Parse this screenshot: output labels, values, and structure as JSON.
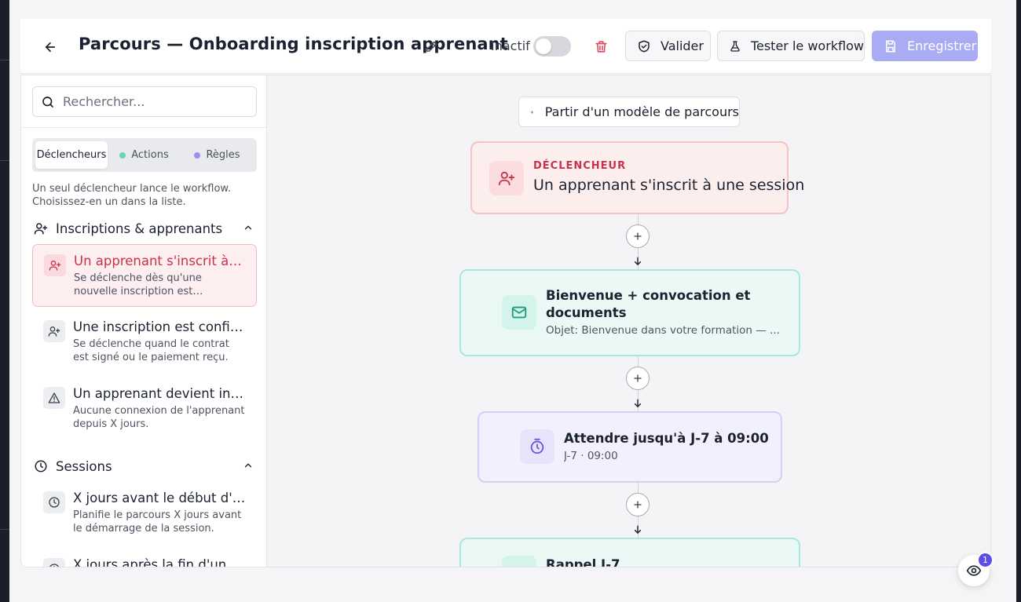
{
  "header": {
    "title": "Parcours — Onboarding inscription apprenant",
    "status_label": "Inactif",
    "validate_label": "Valider",
    "test_label": "Tester le workflow",
    "save_label": "Enregistrer"
  },
  "sidebar": {
    "search_placeholder": "Rechercher...",
    "tabs": [
      {
        "label": "Déclencheurs",
        "active": true
      },
      {
        "label": "Actions",
        "dot_color": "#6fd2b5"
      },
      {
        "label": "Règles",
        "dot_color": "#a08bf0"
      }
    ],
    "hint": "Un seul déclencheur lance le workflow. Choisissez-en un dans la liste.",
    "groups": [
      {
        "title": "Inscriptions & apprenants",
        "icon": "user-plus-icon",
        "items": [
          {
            "title": "Un apprenant s'inscrit à une session",
            "desc": "Se déclenche dès qu'une nouvelle inscription est enregistrée sur une session.",
            "icon": "user-plus-icon",
            "selected": true
          },
          {
            "title": "Une inscription est confirmée",
            "desc": "Se déclenche quand le contrat est signé ou le paiement reçu.",
            "icon": "user-plus-icon"
          },
          {
            "title": "Un apprenant devient inactif",
            "desc": "Aucune connexion de l'apprenant depuis X jours.",
            "icon": "warning-icon"
          }
        ]
      },
      {
        "title": "Sessions",
        "icon": "clock-icon",
        "items": [
          {
            "title": "X jours avant le début d'une session",
            "desc": "Planifie le parcours X jours avant le démarrage de la session.",
            "icon": "clock-icon"
          },
          {
            "title": "X jours après la fin d'une session",
            "desc": "",
            "icon": "clock-icon"
          }
        ]
      }
    ]
  },
  "canvas": {
    "template_button": "Partir d'un modèle de parcours",
    "trigger_node": {
      "kicker": "DÉCLENCHEUR",
      "title": "Un apprenant s'inscrit à une session",
      "color": "#c8324a"
    },
    "email_node": {
      "title": "Bienvenue + convocation et documents",
      "subtitle": "Objet: Bienvenue dans votre formation — ..."
    },
    "wait_node": {
      "title": "Attendre jusqu'à J-7 à 09:00",
      "subtitle": "J-7 · 09:00"
    },
    "reminder_node": {
      "title": "Rappel J-7"
    }
  },
  "floating": {
    "badge": "1"
  }
}
